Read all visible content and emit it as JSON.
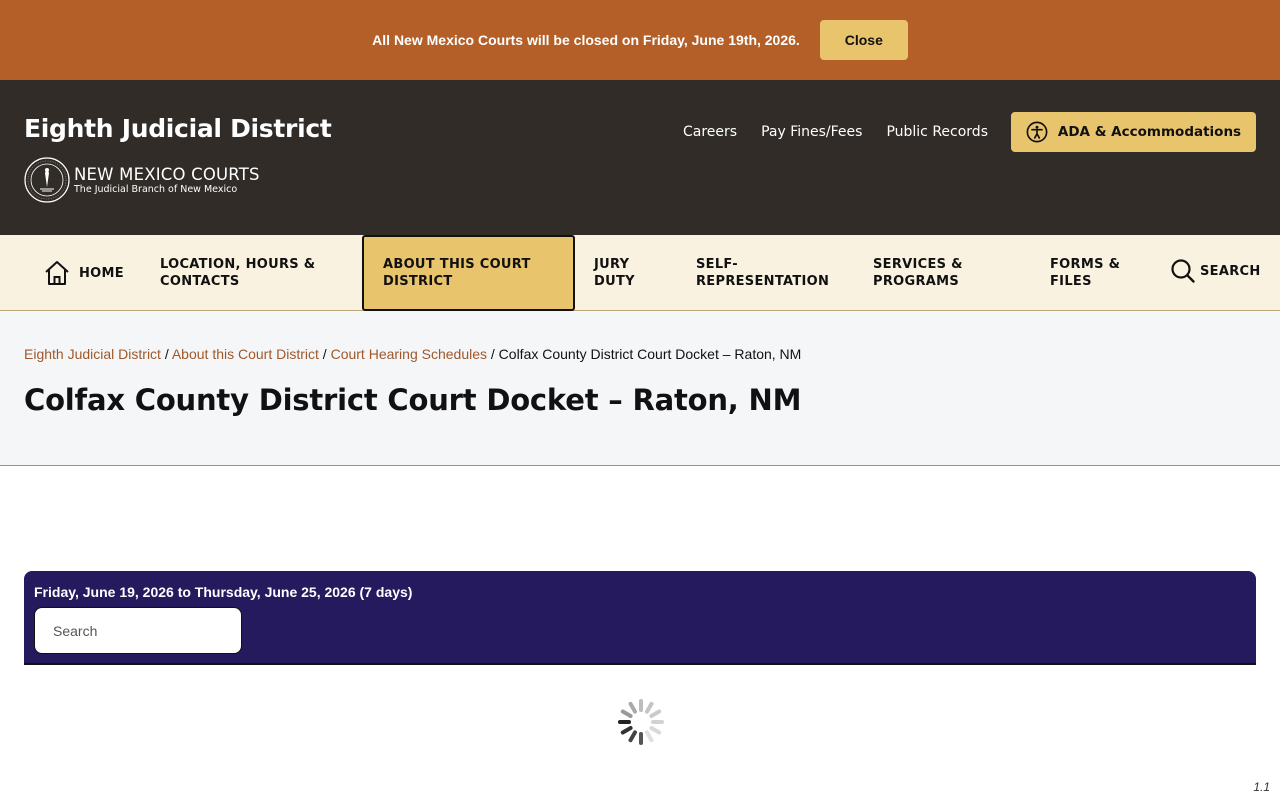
{
  "alert": {
    "message": "All New Mexico Courts will be closed on Friday, June 19th, 2026.",
    "close_label": "Close"
  },
  "header": {
    "site_title": "Eighth Judicial District",
    "brand_name": "NEW MEXICO COURTS",
    "brand_sub": "The Judicial Branch of New Mexico",
    "links": [
      "Careers",
      "Pay Fines/Fees",
      "Public Records"
    ],
    "ada_label": "ADA & Accommodations"
  },
  "nav": {
    "home": "HOME",
    "location": [
      "LOCATION, HOURS &",
      "CONTACTS"
    ],
    "about": [
      "ABOUT THIS COURT",
      "DISTRICT"
    ],
    "jury": [
      "JURY",
      "DUTY"
    ],
    "self_rep": [
      "SELF-",
      "REPRESENTATION"
    ],
    "services": [
      "SERVICES &",
      "PROGRAMS"
    ],
    "forms": [
      "FORMS &",
      "FILES"
    ],
    "search": "SEARCH"
  },
  "breadcrumb": {
    "items": [
      "Eighth Judicial District",
      "About this Court District",
      "Court Hearing Schedules"
    ],
    "current": "Colfax County District Court Docket – Raton, NM",
    "separator": "/"
  },
  "page_title": "Colfax County District Court Docket – Raton, NM",
  "docket": {
    "date_range": "Friday, June 19, 2026 to Thursday, June 25, 2026 (7 days)",
    "search_placeholder": "Search"
  },
  "version": "1.1",
  "colors": {
    "alert_bg": "#b35f27",
    "header_bg": "#312c28",
    "accent": "#e8c46c",
    "nav_bg": "#f9f2e0",
    "docket_bg": "#251a5e",
    "link": "#a0582b"
  }
}
